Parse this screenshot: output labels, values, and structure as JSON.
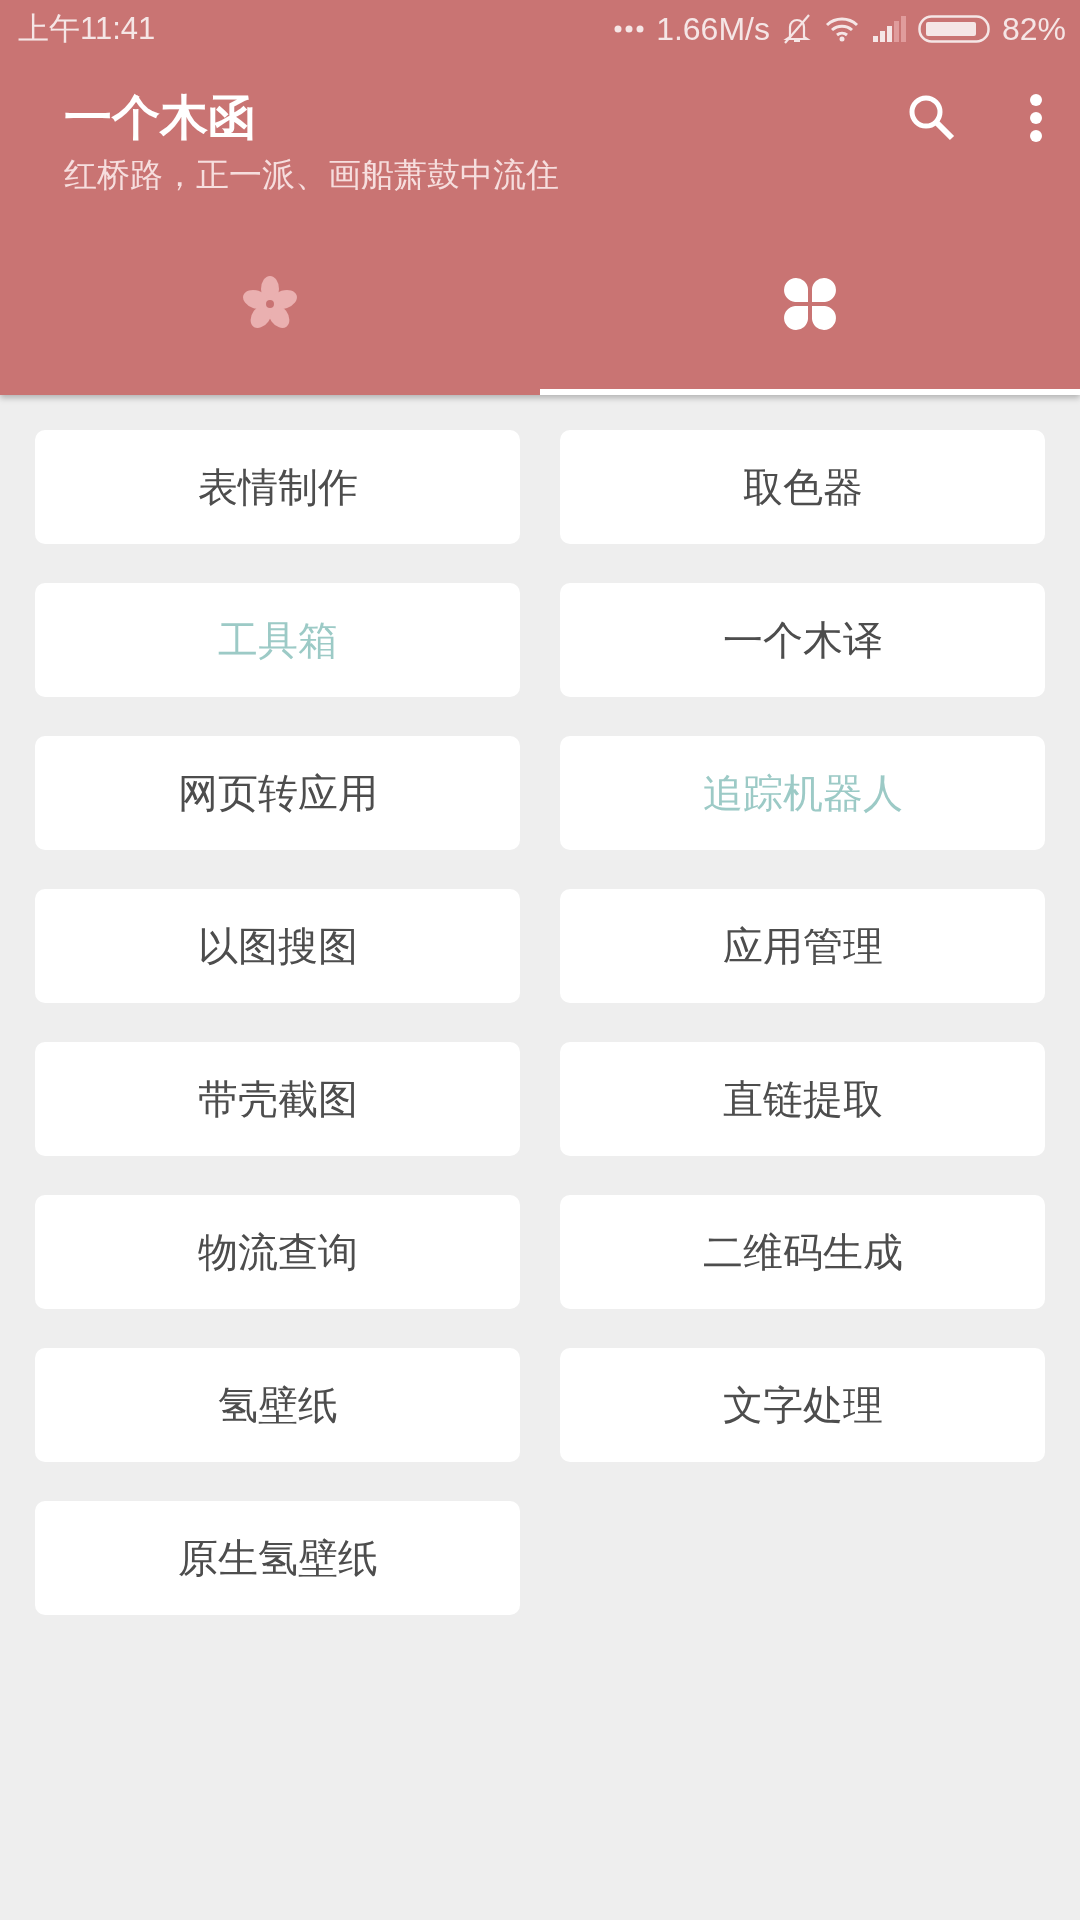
{
  "status_bar": {
    "time": "上午11:41",
    "speed": "1.66M/s",
    "battery": "82%"
  },
  "app_bar": {
    "title": "一个木函",
    "subtitle": "红桥路，正一派、画船萧鼓中流住"
  },
  "tabs": [
    {
      "kind": "flower",
      "selected": false
    },
    {
      "kind": "grid",
      "selected": true
    }
  ],
  "tools": [
    {
      "label": "表情制作",
      "color": "#4d4d4d"
    },
    {
      "label": "取色器",
      "color": "#4d4d4d"
    },
    {
      "label": "工具箱",
      "color": "#9ccac6"
    },
    {
      "label": "一个木译",
      "color": "#4d4d4d"
    },
    {
      "label": "网页转应用",
      "color": "#4d4d4d"
    },
    {
      "label": "追踪机器人",
      "color": "#9ccac6"
    },
    {
      "label": "以图搜图",
      "color": "#4d4d4d"
    },
    {
      "label": "应用管理",
      "color": "#4d4d4d"
    },
    {
      "label": "带壳截图",
      "color": "#4d4d4d"
    },
    {
      "label": "直链提取",
      "color": "#4d4d4d"
    },
    {
      "label": "物流查询",
      "color": "#4d4d4d"
    },
    {
      "label": "二维码生成",
      "color": "#4d4d4d"
    },
    {
      "label": "氢壁纸",
      "color": "#4d4d4d"
    },
    {
      "label": "文字处理",
      "color": "#4d4d4d"
    },
    {
      "label": "原生氢壁纸",
      "color": "#4d4d4d"
    }
  ]
}
